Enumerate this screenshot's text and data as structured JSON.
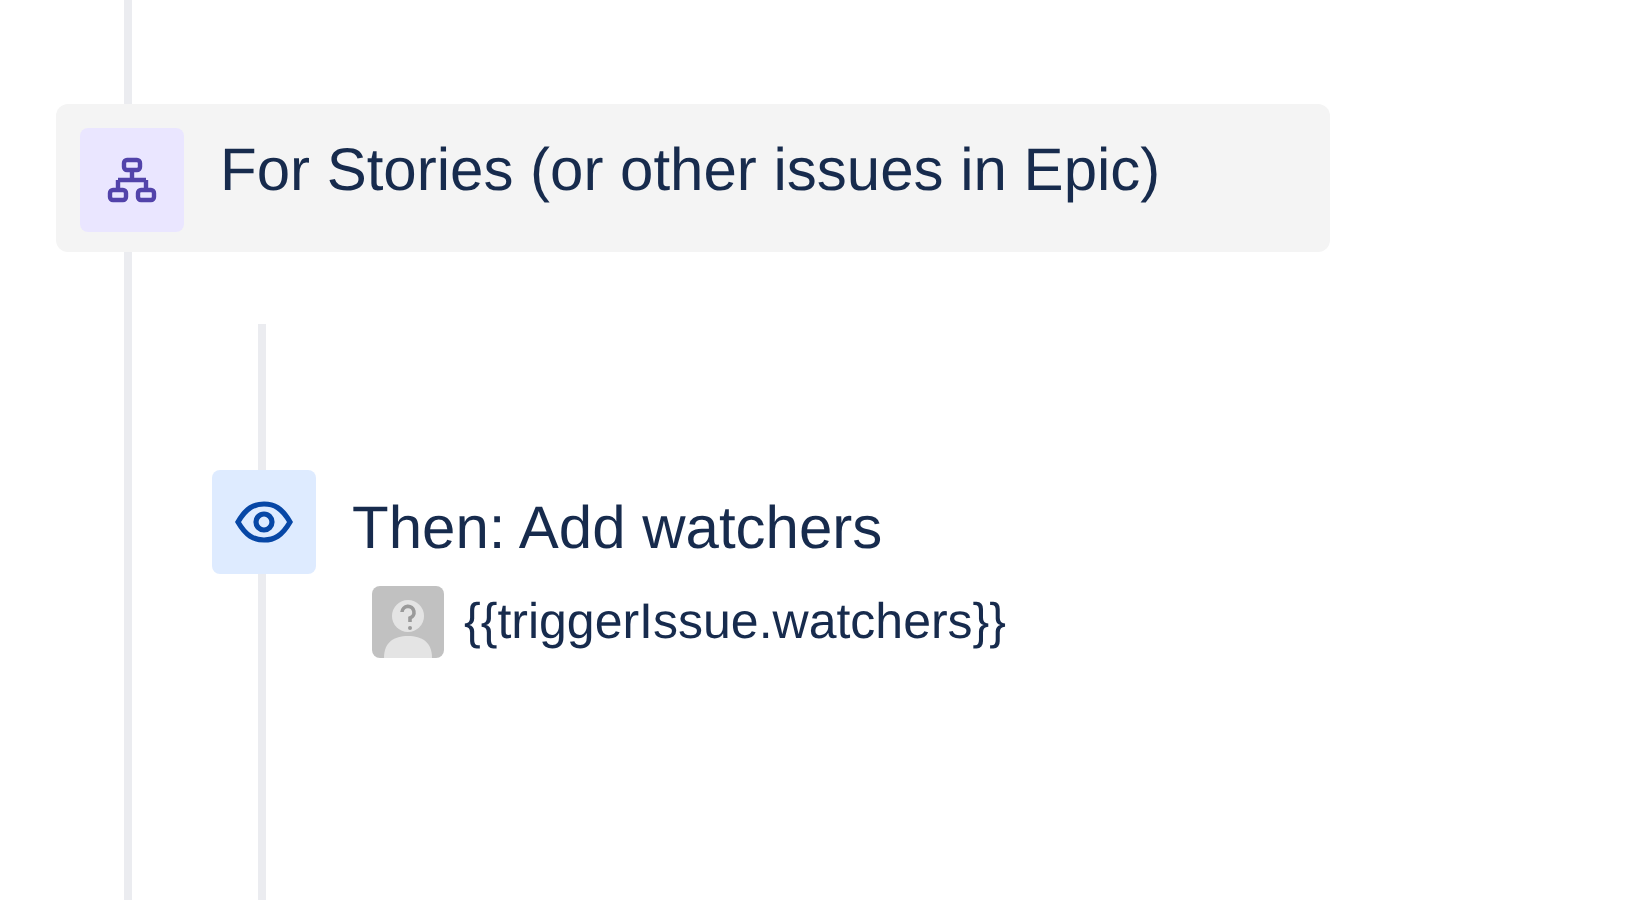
{
  "branch": {
    "title": "For Stories (or other issues in Epic)"
  },
  "action": {
    "title": "Then: Add watchers",
    "value": "{{triggerIssue.watchers}}"
  }
}
